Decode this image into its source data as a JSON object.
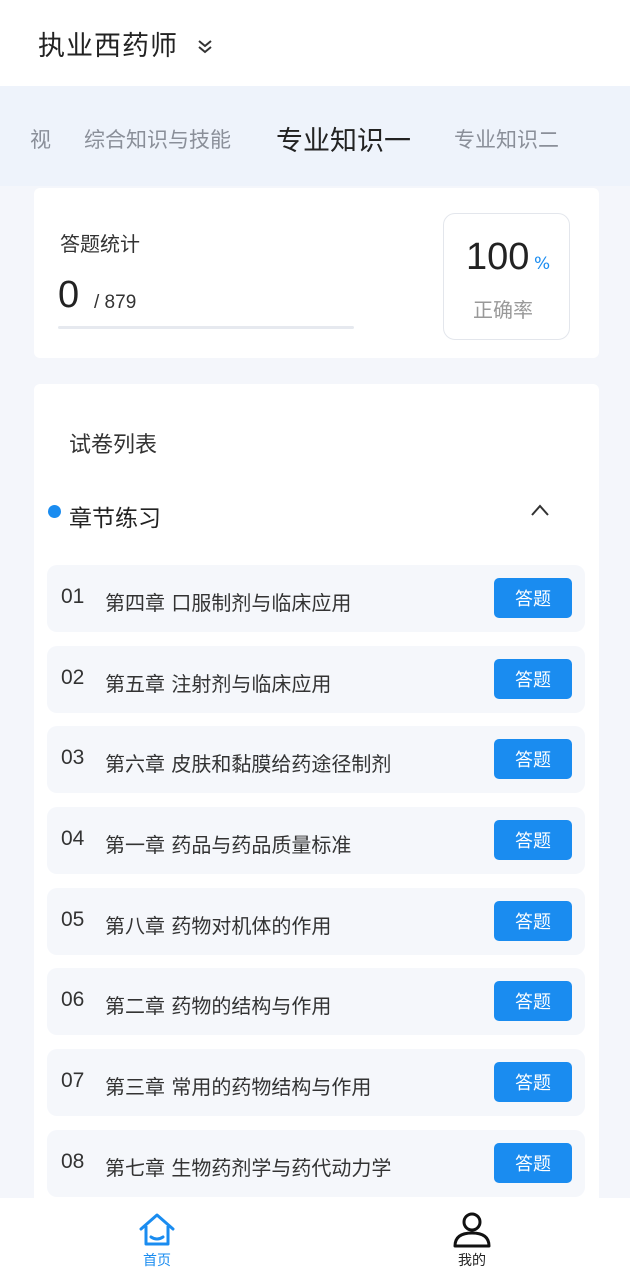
{
  "header": {
    "title": "执业西药师"
  },
  "tabs": [
    {
      "label": "视"
    },
    {
      "label": "综合知识与技能"
    },
    {
      "label": "专业知识一"
    },
    {
      "label": "专业知识二"
    }
  ],
  "stats": {
    "label": "答题统计",
    "answered": "0",
    "total": "/ 879",
    "rate_value": "100",
    "rate_unit": "%",
    "rate_label": "正确率"
  },
  "paper_list": {
    "title": "试卷列表",
    "section_title": "章节练习",
    "button_label": "答题",
    "chapters": [
      {
        "num": "01",
        "name": "第四章 口服制剂与临床应用"
      },
      {
        "num": "02",
        "name": "第五章 注射剂与临床应用"
      },
      {
        "num": "03",
        "name": "第六章 皮肤和黏膜给药途径制剂"
      },
      {
        "num": "04",
        "name": "第一章 药品与药品质量标准"
      },
      {
        "num": "05",
        "name": "第八章 药物对机体的作用"
      },
      {
        "num": "06",
        "name": "第二章 药物的结构与作用"
      },
      {
        "num": "07",
        "name": "第三章 常用的药物结构与作用"
      },
      {
        "num": "08",
        "name": "第七章 生物药剂学与药代动力学"
      }
    ]
  },
  "bottom_nav": {
    "home_label": "首页",
    "mine_label": "我的"
  },
  "colors": {
    "accent": "#1a8cf0"
  }
}
